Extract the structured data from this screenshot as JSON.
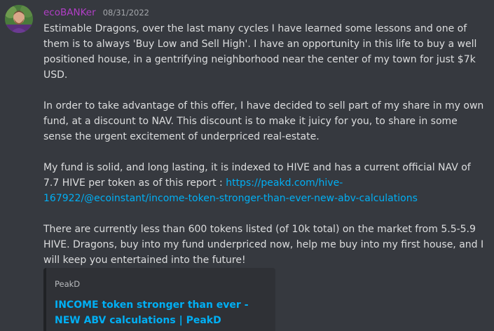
{
  "message": {
    "username": "ecoBANKer",
    "timestamp": "08/31/2022",
    "avatar_icon": "user-avatar",
    "colors": {
      "username": "#b13ec6",
      "link": "#00aff4",
      "background": "#36393f"
    },
    "paragraphs": [
      "Estimable Dragons, over the last many cycles I have learned some lessons and one of them is to always 'Buy Low and Sell High'.  I have an opportunity in this life to buy a well positioned house, in a gentrifying neighborhood near the center of my town for just $7k USD.",
      "In order to take advantage of this offer, I have decided to sell part of my share in my own fund, at a discount to NAV.  This discount is to make it juicy for you, to share in some sense the urgent excitement of underpriced real-estate.",
      "There are currently less than 600 tokens listed (of 10k total) on the market from 5.5-5.9 HIVE.  Dragons, buy into my fund underpriced now, help me buy into my first house, and I will keep you entertained into the future!"
    ],
    "para3_text": "My fund is solid, and long lasting, it is indexed to HIVE and has a current official NAV of 7.7 HIVE per token as of this report : ",
    "para3_link": "https://peakd.com/hive-167922/@ecoinstant/income-token-stronger-than-ever-new-abv-calculations"
  },
  "embed": {
    "provider": "PeakD",
    "title": "INCOME token stronger than ever - NEW ABV calculations | PeakD"
  }
}
